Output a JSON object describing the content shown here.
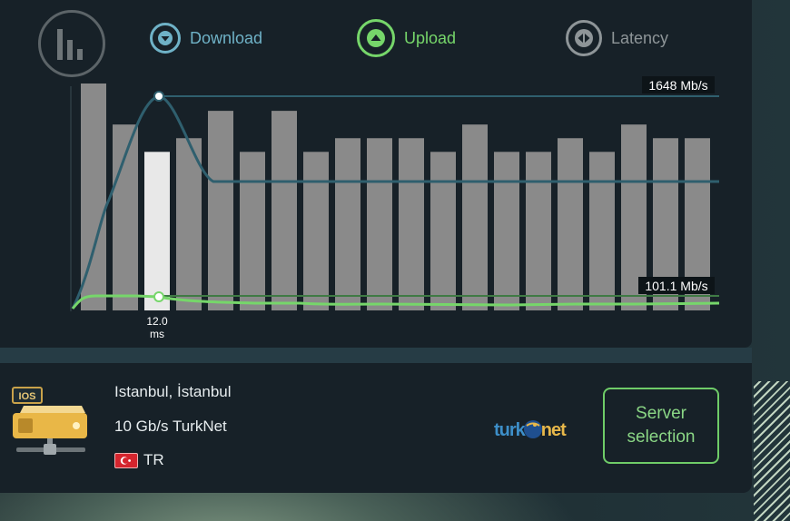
{
  "tabs": [
    {
      "label": "Download"
    },
    {
      "label": "Upload"
    },
    {
      "label": "Latency"
    }
  ],
  "chart_data": {
    "type": "bar",
    "bar_values": [
      83,
      68,
      58,
      63,
      73,
      58,
      73,
      58,
      63,
      63,
      63,
      58,
      68,
      58,
      58,
      63,
      58,
      68,
      63,
      63
    ],
    "highlight_index": 2,
    "download_peak_label": "1648 Mb/s",
    "upload_peak_label": "101.1 Mb/s",
    "latency_label_value": "12.0",
    "latency_label_unit": "ms",
    "series": [
      {
        "name": "Download",
        "color": "#2f5f6e",
        "peak": 1648
      },
      {
        "name": "Upload",
        "color": "#76d66a",
        "peak": 101.1
      }
    ]
  },
  "server": {
    "os_badge": "IOS",
    "city": "Istanbul, İstanbul",
    "provider": "10 Gb/s TurkNet",
    "country": "TR",
    "logo_left": "turk",
    "logo_right": "net",
    "button_line1": "Server",
    "button_line2": "selection"
  },
  "colors": {
    "download": "#6fb2c7",
    "upload": "#76d66a",
    "latency": "#8e9598",
    "panel": "#172128",
    "bar": "#8a8a8a",
    "bar_highlight": "#e8e8e8"
  }
}
